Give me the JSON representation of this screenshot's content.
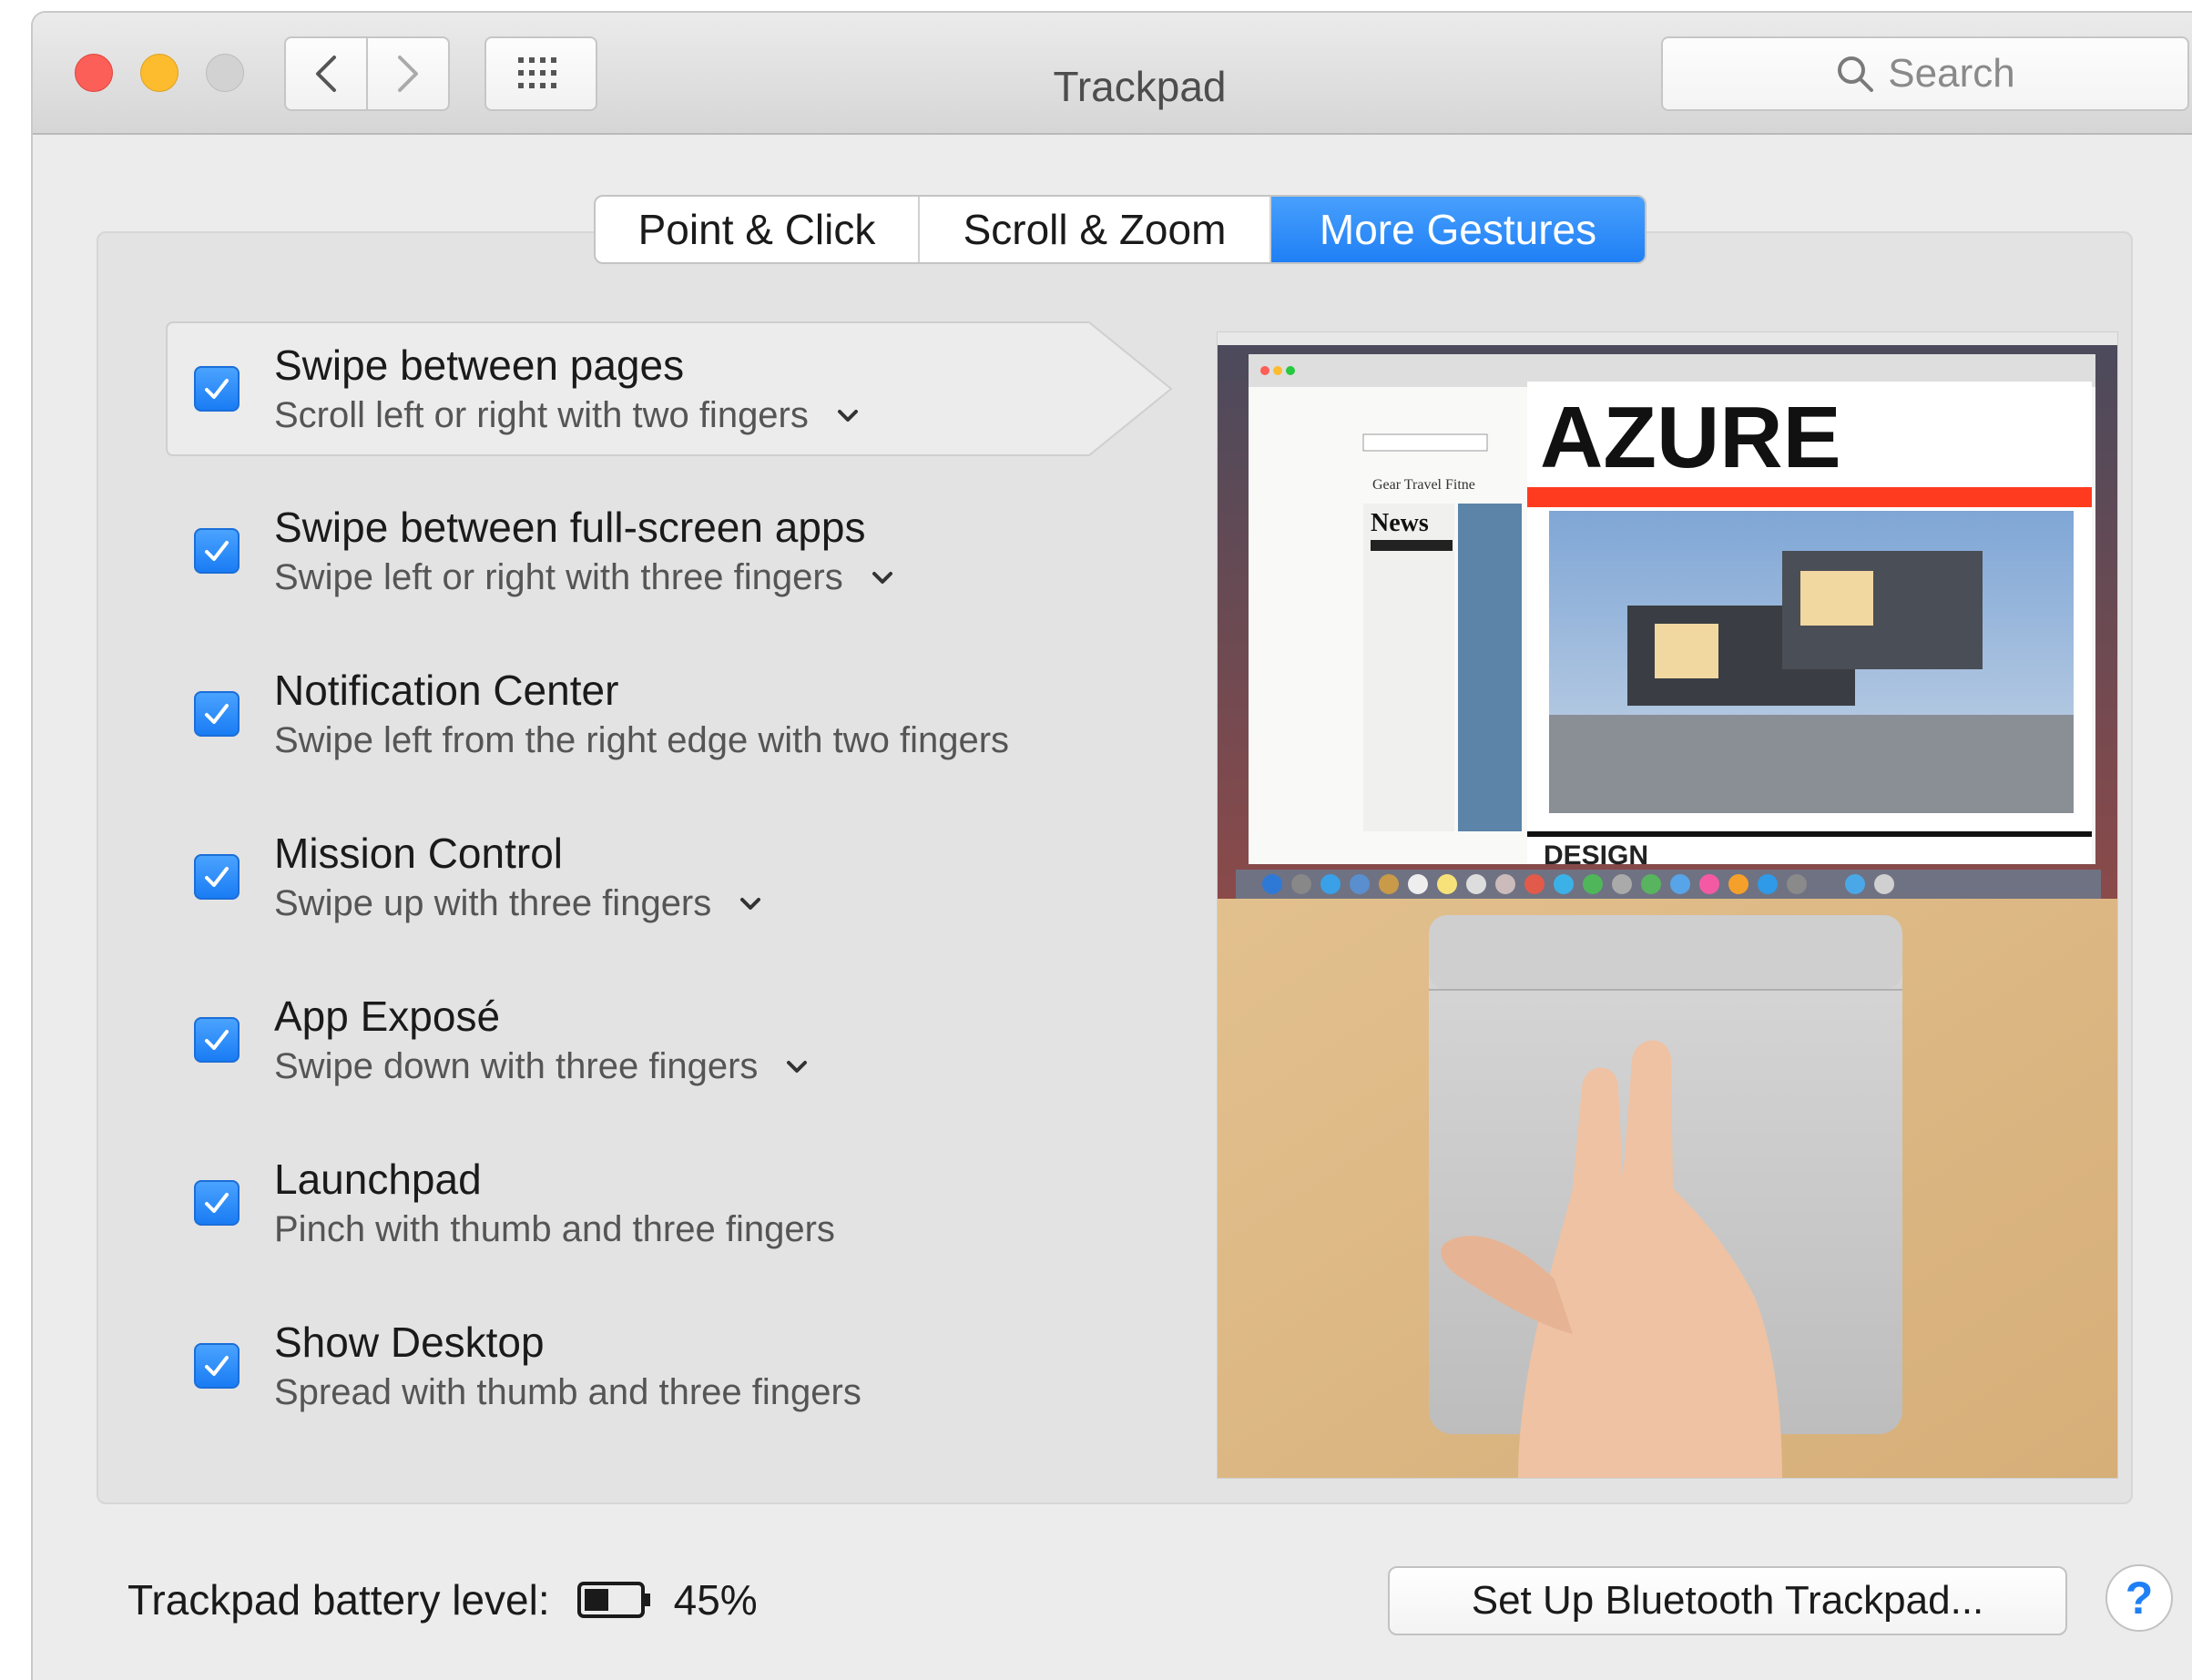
{
  "window": {
    "title": "Trackpad"
  },
  "toolbar": {
    "search_placeholder": "Search",
    "back_icon": "chevron-left-icon",
    "forward_icon": "chevron-right-icon",
    "grid_icon": "grid-icon"
  },
  "tabs": [
    {
      "label": "Point & Click",
      "active": false
    },
    {
      "label": "Scroll & Zoom",
      "active": false
    },
    {
      "label": "More Gestures",
      "active": true
    }
  ],
  "gestures": [
    {
      "title": "Swipe between pages",
      "subtitle": "Scroll left or right with two fingers",
      "checked": true,
      "has_menu": true,
      "selected": true
    },
    {
      "title": "Swipe between full-screen apps",
      "subtitle": "Swipe left or right with three fingers",
      "checked": true,
      "has_menu": true,
      "selected": false
    },
    {
      "title": "Notification Center",
      "subtitle": "Swipe left from the right edge with two fingers",
      "checked": true,
      "has_menu": false,
      "selected": false
    },
    {
      "title": "Mission Control",
      "subtitle": "Swipe up with three fingers",
      "checked": true,
      "has_menu": true,
      "selected": false
    },
    {
      "title": "App Exposé",
      "subtitle": "Swipe down with three fingers",
      "checked": true,
      "has_menu": true,
      "selected": false
    },
    {
      "title": "Launchpad",
      "subtitle": "Pinch with thumb and three fingers",
      "checked": true,
      "has_menu": false,
      "selected": false
    },
    {
      "title": "Show Desktop",
      "subtitle": "Spread with thumb and three fingers",
      "checked": true,
      "has_menu": false,
      "selected": false
    }
  ],
  "preview": {
    "magazine_title": "AZURE",
    "news_heading": "News",
    "section_label": "DESIGN",
    "menu_items": [
      "Gear",
      "Travel",
      "Fitne"
    ]
  },
  "footer": {
    "battery_label": "Trackpad battery level:",
    "battery_percent": "45%",
    "battery_level": 0.45,
    "setup_button": "Set Up Bluetooth Trackpad...",
    "help_label": "?"
  },
  "colors": {
    "accent": "#1f7ff5",
    "close": "#fc5f57",
    "minimize": "#fdbc2e",
    "zoom": "#d2d2d2"
  }
}
